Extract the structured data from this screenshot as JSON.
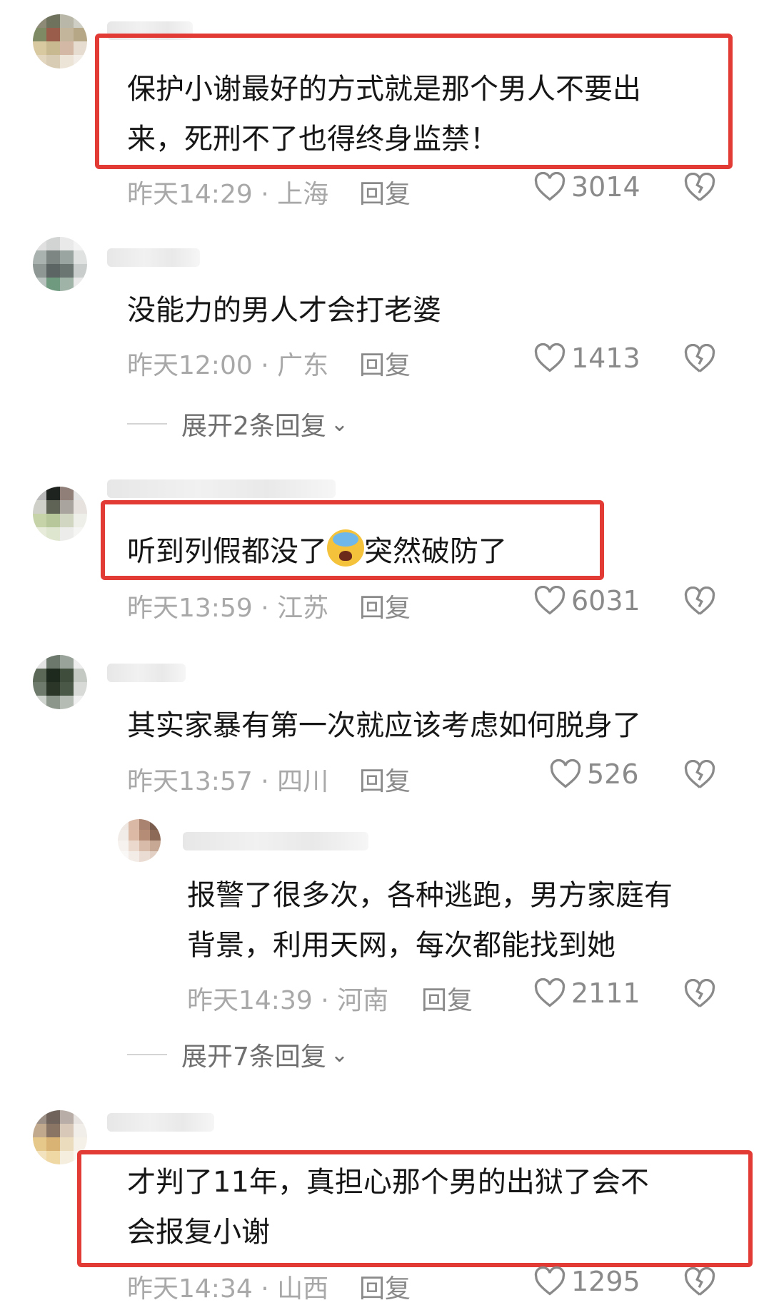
{
  "comments": [
    {
      "text": [
        "保护小谢最好的方式就是那个男人不要出",
        "来，死刑不了也得终身监禁！"
      ],
      "meta": "昨天14:29 · 上海",
      "reply": "回复",
      "likes": "3014"
    },
    {
      "text": [
        "没能力的男人才会打老婆"
      ],
      "meta": "昨天12:00 · 广东",
      "reply": "回复",
      "likes": "1413",
      "expand": "展开2条回复"
    },
    {
      "text_before_emoji": "听到列假都没了",
      "emoji": "loudly-crying-face",
      "text_after_emoji": "突然破防了",
      "meta": "昨天13:59 · 江苏",
      "reply": "回复",
      "likes": "6031"
    },
    {
      "text": [
        "其实家暴有第一次就应该考虑如何脱身了"
      ],
      "meta": "昨天13:57 · 四川",
      "reply": "回复",
      "likes": "526"
    },
    {
      "text": [
        "报警了很多次，各种逃跑，男方家庭有",
        "背景，利用天网，每次都能找到她"
      ],
      "meta": "昨天14:39 · 河南",
      "reply": "回复",
      "likes": "2111",
      "expand": "展开7条回复"
    },
    {
      "text": [
        "才判了11年，真担心那个男的出狱了会不",
        "会报复小谢"
      ],
      "meta": "昨天14:34 · 山西",
      "reply": "回复",
      "likes": "1295"
    }
  ],
  "colors": {
    "highlight": "#e23b36",
    "meta": "#a8a8a8",
    "text": "#161616"
  }
}
